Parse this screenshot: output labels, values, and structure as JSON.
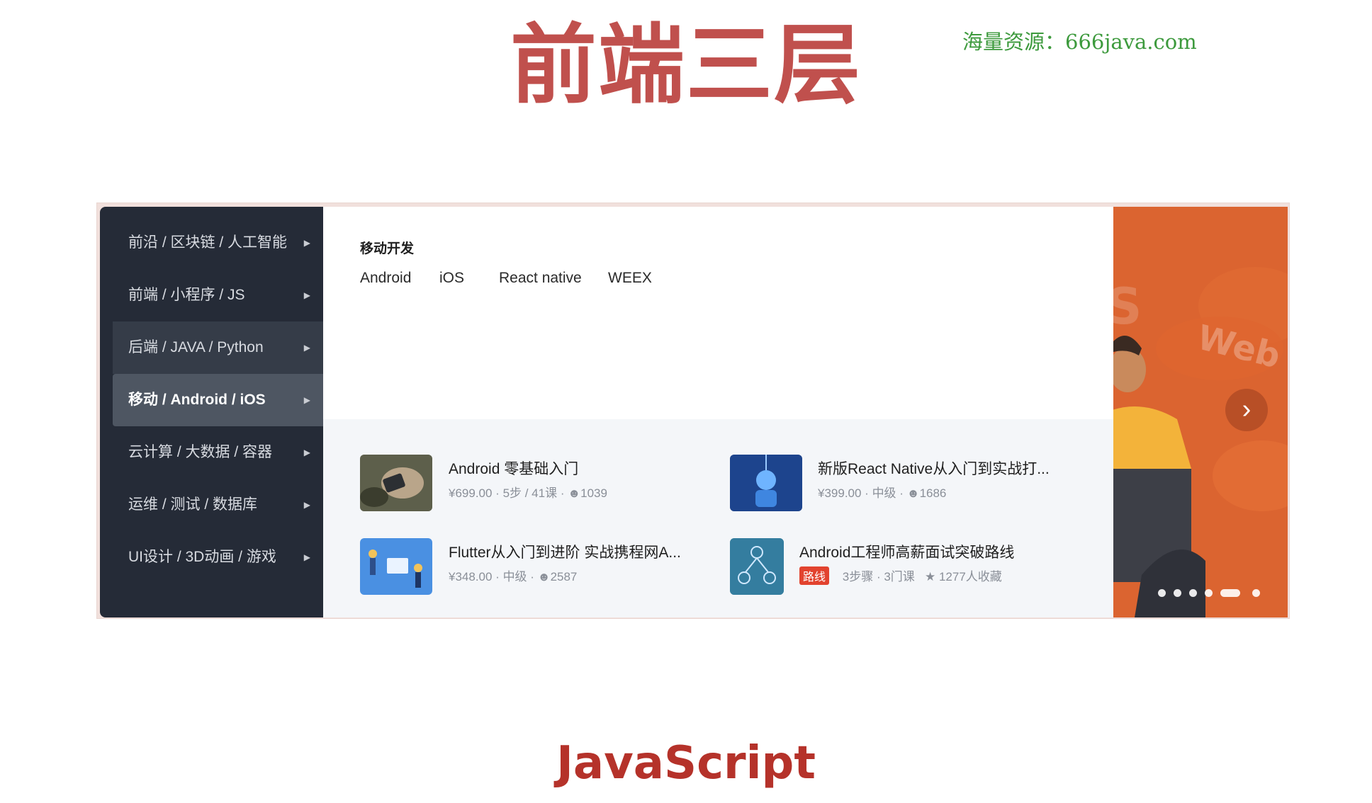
{
  "slide": {
    "title": "前端三层",
    "watermark": "海量资源：666java.com",
    "footer": "JavaScript"
  },
  "sidebar": {
    "items": [
      {
        "label": "前沿 / 区块链 / 人工智能"
      },
      {
        "label": "前端 / 小程序 / JS"
      },
      {
        "label": "后端 / JAVA / Python"
      },
      {
        "label": "移动 / Android / iOS"
      },
      {
        "label": "云计算 / 大数据 / 容器"
      },
      {
        "label": "运维 / 测试 / 数据库"
      },
      {
        "label": "UI设计 / 3D动画 / 游戏"
      }
    ],
    "active_index": 3
  },
  "menu": {
    "category_title": "移动开发",
    "tags": [
      "Android",
      "iOS",
      "React native",
      "WEEX"
    ]
  },
  "courses": [
    {
      "title": "Android 零基础入门",
      "price": "¥699.00",
      "meta": "5步 / 41课",
      "learners": "1039"
    },
    {
      "title": "新版React Native从入门到实战打...",
      "price": "¥399.00",
      "meta": "中级",
      "learners": "1686"
    },
    {
      "title": "Flutter从入门到进阶 实战携程网A...",
      "price": "¥348.00",
      "meta": "中级",
      "learners": "2587"
    },
    {
      "title": "Android工程师高薪面试突破路线",
      "badge": "路线",
      "steps": "3步骤",
      "courses": "3门课",
      "favorites": "1277人收藏"
    }
  ],
  "banner": {
    "text_web": "Web",
    "text_s": "S",
    "next_icon": "chevron-right-icon",
    "slide_count": 6,
    "active_slide": 4
  },
  "colors": {
    "title": "#c0504d",
    "watermark": "#3d9a3d",
    "footer": "#b5322a",
    "sidebar_bg": "#252b37",
    "banner_bg": "#d3592b",
    "badge": "#e2432f"
  }
}
